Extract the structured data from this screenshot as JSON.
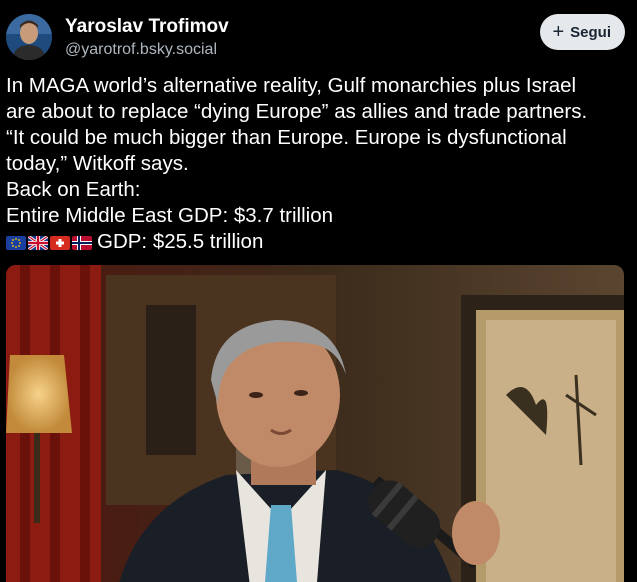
{
  "author": {
    "display_name": "Yaroslav Trofimov",
    "handle": "@yarotrof.bsky.social",
    "avatar_icon": "person-avatar"
  },
  "follow_button": {
    "label": "Segui",
    "icon": "plus-icon"
  },
  "post": {
    "lines": [
      "In MAGA world’s alternative reality, Gulf monarchies plus Israel",
      "are about to replace “dying Europe” as allies and trade partners.",
      "“It could be much bigger than Europe. Europe is dysfunctional",
      "today,” Witkoff says.",
      "Back on Earth:",
      "Entire Middle East GDP: $3.7 trillion"
    ],
    "flags": [
      "EU",
      "UK",
      "CH",
      "NO"
    ],
    "gdp_line": "GDP: $25.5 trillion"
  },
  "media": {
    "kind": "video-still",
    "description_icon": "man-speaking-into-microphone"
  },
  "colors": {
    "background": "#000000",
    "text": "#ffffff",
    "handle": "#aeb6bf",
    "button_bg": "#e6e9ec",
    "button_text": "#1a2634"
  }
}
